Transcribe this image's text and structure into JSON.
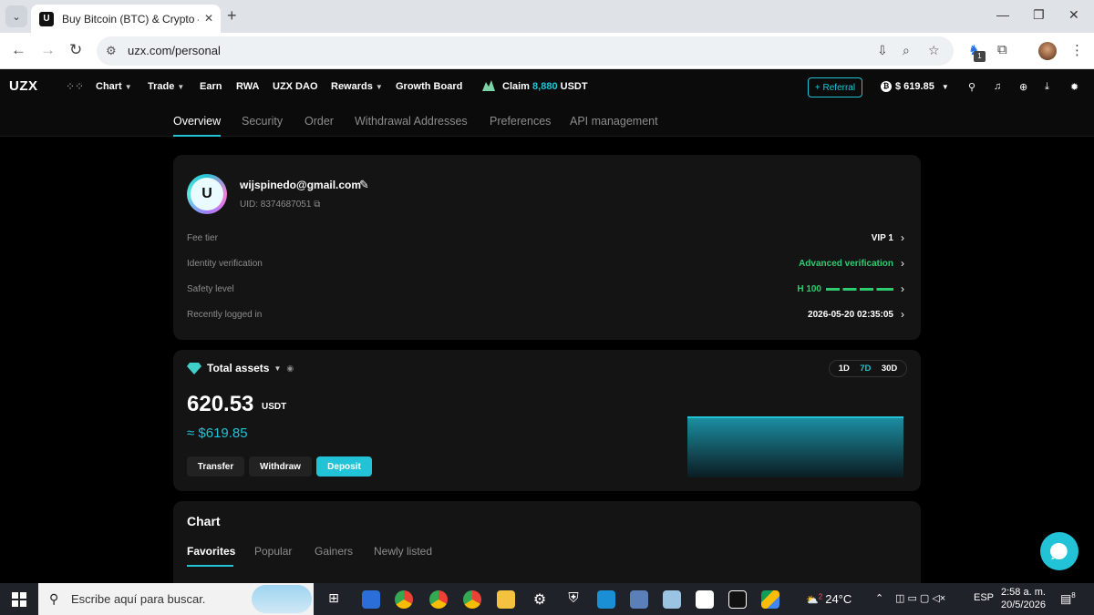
{
  "browser": {
    "tab_title": "Buy Bitcoin (BTC) & Crypto — C",
    "tab_favicon": "U",
    "url": "uzx.com/personal",
    "extension_badge": "1"
  },
  "app": {
    "logo": "UZX",
    "menu": [
      {
        "label": "Chart",
        "caret": true
      },
      {
        "label": "Trade",
        "caret": true
      },
      {
        "label": "Earn",
        "caret": false
      },
      {
        "label": "RWA",
        "caret": false
      },
      {
        "label": "UZX DAO",
        "caret": false
      },
      {
        "label": "Rewards",
        "caret": true
      },
      {
        "label": "Growth Board",
        "caret": false
      }
    ],
    "claim_prefix": "Claim",
    "claim_amount": "8,880",
    "claim_suffix": "USDT",
    "referral_label": "+ Referral",
    "balance": "$ 619.85"
  },
  "subnav": [
    "Overview",
    "Security",
    "Order",
    "Withdrawal Addresses",
    "Preferences",
    "API management"
  ],
  "profile": {
    "email": "wijspinedo@gmail.com",
    "uid": "UID: 8374687051",
    "rows": [
      {
        "label": "Fee tier",
        "value": "VIP 1"
      },
      {
        "label": "Identity verification",
        "value": "Advanced verification"
      },
      {
        "label": "Safety level",
        "value": "H 100"
      },
      {
        "label": "Recently logged in",
        "value": "2026-05-20 02:35:05"
      }
    ]
  },
  "assets": {
    "title": "Total assets",
    "ranges": [
      "1D",
      "7D",
      "30D"
    ],
    "active_range": "7D",
    "amount": "620.53",
    "unit": "USDT",
    "fiat": "≈ $619.85",
    "buttons": [
      "Transfer",
      "Withdraw",
      "Deposit"
    ]
  },
  "chart_section": {
    "title": "Chart",
    "tabs": [
      "Favorites",
      "Popular",
      "Gainers",
      "Newly listed"
    ]
  },
  "taskbar": {
    "search_placeholder": "Escribe aquí para buscar.",
    "weather": "24°C",
    "weather_badge": "2",
    "language": "ESP",
    "time": "2:58 a. m.",
    "date": "20/5/2026",
    "notifications": "8"
  },
  "colors": {
    "accent": "#22c3d6",
    "success": "#2ecc71",
    "card": "#141414"
  }
}
